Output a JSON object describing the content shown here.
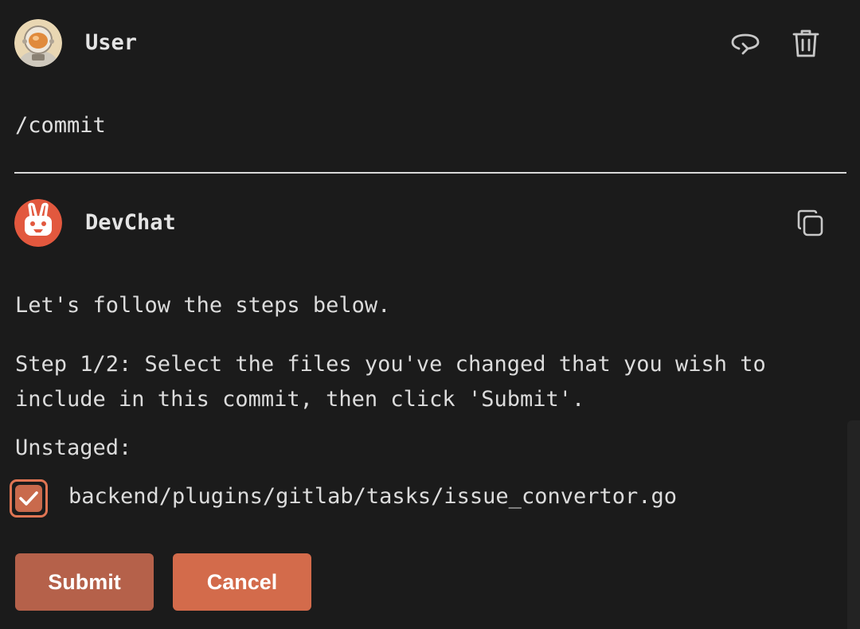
{
  "user_message": {
    "author": "User",
    "text": "/commit",
    "avatar_icon": "astronaut-avatar",
    "actions": [
      {
        "icon": "redo-icon"
      },
      {
        "icon": "trash-icon"
      }
    ]
  },
  "assistant_message": {
    "author": "DevChat",
    "avatar_icon": "rabbit-logo",
    "avatar_color": "#e2583e",
    "copy_icon": "copy-icon",
    "intro": "Let's follow the steps below.",
    "step": "Step 1/2: Select the files you've changed that you wish to include in this commit, then click 'Submit'.",
    "unstaged_label": "Unstaged:",
    "files": [
      {
        "path": "backend/plugins/gitlab/tasks/issue_convertor.go",
        "checked": true
      }
    ],
    "buttons": {
      "submit": "Submit",
      "cancel": "Cancel"
    }
  },
  "colors": {
    "background": "#1b1b1b",
    "accent": "#d36b4b",
    "submit_bg": "#b5614a"
  }
}
